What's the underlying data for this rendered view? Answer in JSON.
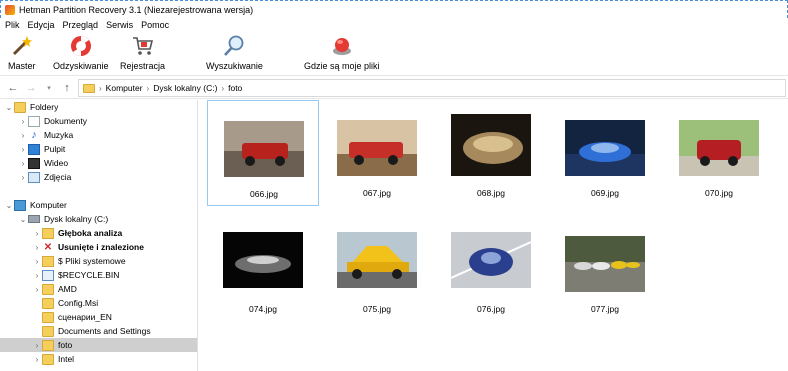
{
  "window": {
    "title": "Hetman Partition Recovery 3.1 (Niezarejestrowana wersja)"
  },
  "menu": [
    "Plik",
    "Edycja",
    "Przegląd",
    "Serwis",
    "Pomoc"
  ],
  "toolbar": {
    "master": "Master",
    "recovery": "Odzyskiwanie",
    "registration": "Rejestracja",
    "search": "Wyszukiwanie",
    "where_files": "Gdzie są moje pliki"
  },
  "address": {
    "crumbs": [
      "Komputer",
      "Dysk lokalny (C:)",
      "foto"
    ]
  },
  "tree": {
    "folders_label": "Foldery",
    "items": [
      "Dokumenty",
      "Muzyka",
      "Pulpit",
      "Wideo",
      "Zdjęcia"
    ],
    "computer_label": "Komputer",
    "drive_label": "Dysk lokalny (C:)",
    "drive_items": [
      "Głęboka analiza",
      "Usunięte i znalezione",
      "$ Pliki systemowe",
      "$RECYCLE.BIN",
      "AMD",
      "Config.Msi",
      "сценарии_EN",
      "Documents and Settings",
      "foto",
      "Intel"
    ]
  },
  "files": [
    "066.jpg",
    "067.jpg",
    "068.jpg",
    "069.jpg",
    "070.jpg",
    "074.jpg",
    "075.jpg",
    "076.jpg",
    "077.jpg"
  ],
  "colors": {
    "accent": "#99c9ef",
    "selection": "#cfcfcf",
    "folder": "#f4cf5c"
  }
}
